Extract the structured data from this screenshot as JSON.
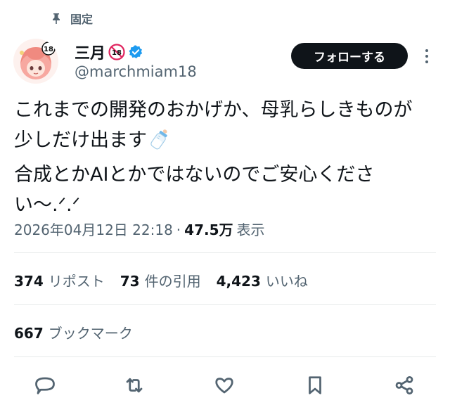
{
  "pinned": {
    "label": "固定",
    "icon": "pin-icon"
  },
  "author": {
    "display_name": "三月",
    "badge_text": "18",
    "handle": "@marchmiam18",
    "verified_color": "#1d9bf0"
  },
  "follow_button": {
    "label": "フォローする"
  },
  "tweet": {
    "lines": [
      "これまでの開発のおかげか、母乳らしきものが",
      "少しだけ出ます",
      "合成とかAIとかではないのでご安心くださ",
      "い〜.ᐟ.ᐟ"
    ],
    "emoji": "baby-bottle-icon"
  },
  "meta": {
    "timestamp": "2026年04月12日 22:18",
    "separator": "·",
    "views": "47.5万",
    "views_label": "表示"
  },
  "stats": {
    "reposts": {
      "count": "374",
      "label": "リポスト"
    },
    "quotes": {
      "count": "73",
      "label": "件の引用"
    },
    "likes": {
      "count": "4,423",
      "label": "いいね"
    }
  },
  "bookmarks": {
    "count": "667",
    "label": "ブックマーク"
  },
  "actions": [
    "reply-icon",
    "repost-icon",
    "like-icon",
    "bookmark-icon",
    "share-icon"
  ],
  "colors": {
    "text": "#0f1419",
    "secondary": "#536471",
    "divider": "#e7e9ea",
    "badge": "#e0245e"
  }
}
